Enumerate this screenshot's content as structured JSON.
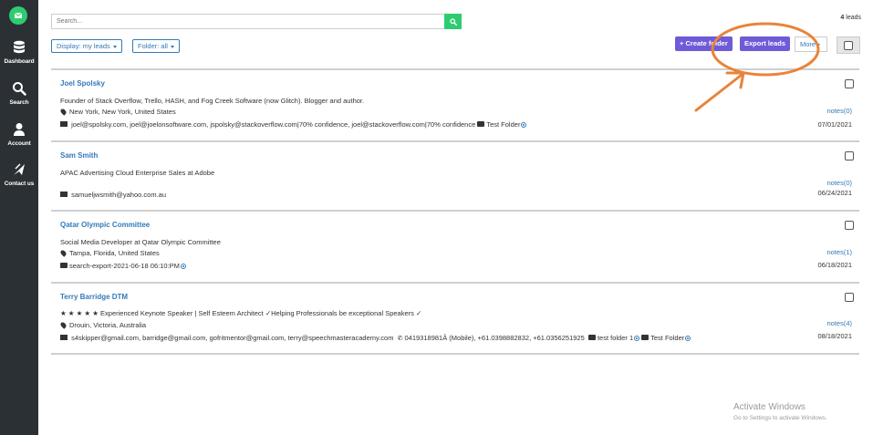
{
  "sidebar": {
    "logo_icon": "chat-mail-icon",
    "items": [
      {
        "label": "Dashboard",
        "icon": "database-icon"
      },
      {
        "label": "Search",
        "icon": "search-icon"
      },
      {
        "label": "Account",
        "icon": "user-icon"
      },
      {
        "label": "Contact us",
        "icon": "paper-plane-icon"
      }
    ]
  },
  "search": {
    "placeholder": "Search..."
  },
  "lead_count": {
    "number": "4",
    "label": "leads"
  },
  "toolbar": {
    "display_label": "Display: my leads",
    "folder_label": "Folder: all",
    "create_folder_label": "Create folder",
    "export_label": "Export leads",
    "more_label": "More"
  },
  "leads": [
    {
      "name": "Joel Spolsky",
      "headline": "Founder of Stack Overflow, Trello, HASH, and Fog Creek Software (now Glitch). Blogger and author.",
      "location": "New York, New York, United States",
      "emails": "joel@spolsky.com, joel@joelonsoftware.com, jspolsky@stackoverflow.com|70% confidence, joel@stackoverflow.com|70% confidence",
      "folders": [
        "Test Folder"
      ],
      "notes": "notes(0)",
      "date": "07/01/2021"
    },
    {
      "name": "Sam Smith",
      "headline": "APAC Advertising Cloud Enterprise Sales at Adobe",
      "emails": "samueljwsmith@yahoo.com.au",
      "notes": "notes(0)",
      "date": "06/24/2021"
    },
    {
      "name": "Qatar Olympic Committee",
      "headline": "Social Media Developer at Qatar Olympic Committee",
      "location": "Tampa, Florida, United States",
      "folders": [
        "search-export-2021-06-18 06:10:PM"
      ],
      "notes": "notes(1)",
      "date": "06/18/2021"
    },
    {
      "name": "Terry Barridge DTM",
      "headline": "★ ★ ★ ★ ★ Experienced Keynote Speaker | Self Esteem Architect ✓Helping Professionals be exceptional Speakers ✓",
      "location": "Drouin, Victoria, Australia",
      "emails": "s4skipper@gmail.com, barridge@gmail.com, gofritmentor@gmail.com, terry@speechmasteracademy.com",
      "phones": "0419318981Â (Mobile), +61.0398882832, +61.0356251925",
      "folders": [
        "test folder 1",
        "Test Folder"
      ],
      "notes": "notes(4)",
      "date": "08/18/2021"
    }
  ],
  "watermark": {
    "title": "Activate Windows",
    "subtitle": "Go to Settings to activate Windows."
  },
  "colors": {
    "sidebar": "#2b3034",
    "accent_green": "#2ecc71",
    "button_purple": "#6f5ad8",
    "link_blue": "#337ab7",
    "annotation_orange": "#e8843a"
  }
}
